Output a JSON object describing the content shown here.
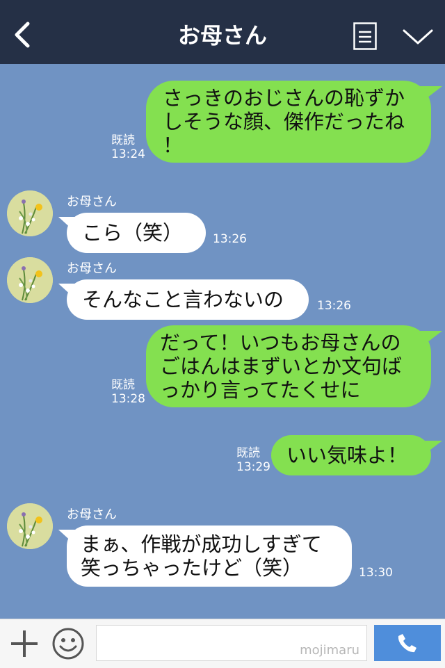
{
  "header": {
    "title": "お母さん"
  },
  "messages": [
    {
      "dir": "out",
      "text_lines": [
        "さっきのおじさんの恥ずか",
        "しそうな顔、傑作だったね",
        "！"
      ],
      "read": "既読",
      "time": "13:24"
    },
    {
      "dir": "in",
      "sender": "お母さん",
      "text": "こら（笑）",
      "time": "13:26"
    },
    {
      "dir": "in",
      "sender": "お母さん",
      "text": "そんなこと言わないの",
      "time": "13:26"
    },
    {
      "dir": "out",
      "text_lines": [
        "だって！いつもお母さんの",
        "ごはんはまずいとか文句ば",
        "っかり言ってたくせに"
      ],
      "read": "既読",
      "time": "13:28"
    },
    {
      "dir": "out",
      "text": "いい気味よ！",
      "read": "既読",
      "time": "13:29"
    },
    {
      "dir": "in",
      "sender": "お母さん",
      "text_lines": [
        "まぁ、作戦が成功しすぎて",
        "笑っちゃったけど（笑）"
      ],
      "time": "13:30"
    }
  ],
  "footer": {
    "watermark": "mojimaru"
  },
  "icons": {
    "back": "back-chevron-icon",
    "menu": "menu-list-icon",
    "collapse": "chevron-down-icon",
    "plus": "plus-icon",
    "emoji": "smiley-icon",
    "call": "phone-icon"
  },
  "colors": {
    "header_bg": "#253046",
    "chat_bg": "#7093c3",
    "out_bubble": "#84e050",
    "in_bubble": "#ffffff",
    "call_button": "#4f8edb"
  }
}
